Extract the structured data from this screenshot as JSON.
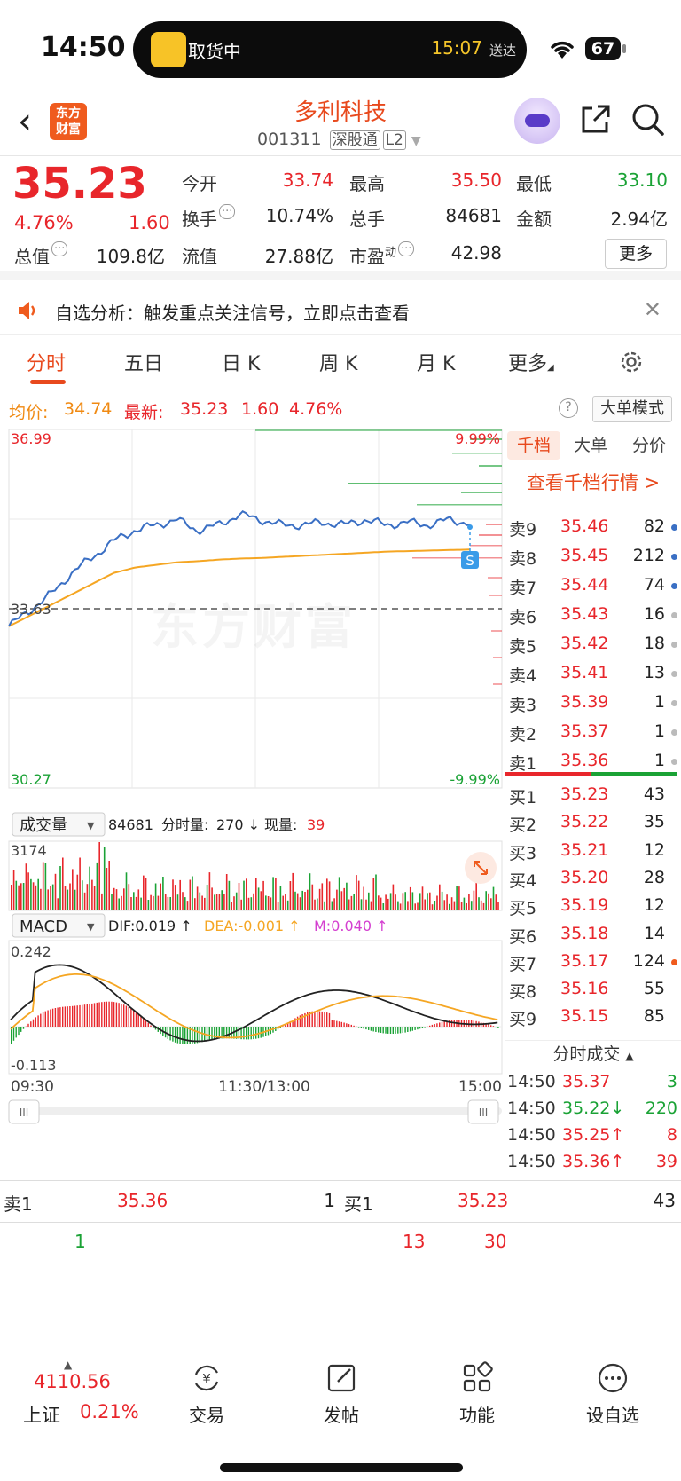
{
  "status": {
    "time": "14:50",
    "island_text": "取货中",
    "island_time": "15:07",
    "island_suffix": "送达",
    "battery": "67"
  },
  "header": {
    "stock_name": "多利科技",
    "code": "001311",
    "tag1": "深股通",
    "tag2": "L2",
    "logo_line1": "东方",
    "logo_line2": "财富"
  },
  "quote": {
    "price": "35.23",
    "pct": "4.76%",
    "chg": "1.60",
    "open_label": "今开",
    "open": "33.74",
    "high_label": "最高",
    "high": "35.50",
    "low_label": "最低",
    "low": "33.10",
    "turnover_label": "换手",
    "turnover": "10.74%",
    "vol_label": "总手",
    "vol": "84681",
    "amount_label": "金额",
    "amount": "2.94亿",
    "mktcap_label": "总值",
    "mktcap": "109.8亿",
    "float_label": "流值",
    "float": "27.88亿",
    "pe_label": "市盈",
    "pe_sup": "动",
    "pe": "42.98",
    "more": "更多"
  },
  "notice": {
    "text": "自选分析：触发重点关注信号，立即点击查看"
  },
  "tabs": [
    "分时",
    "五日",
    "日 K",
    "周 K",
    "月 K",
    "更多"
  ],
  "avgrow": {
    "avg_label": "均价:",
    "avg": "34.74",
    "latest_label": "最新:",
    "latest": "35.23",
    "chg": "1.60",
    "pct": "4.76%",
    "big_mode": "大单模式",
    "help": "?"
  },
  "chart": {
    "y_top": "36.99",
    "y_mid": "33.63",
    "y_bot": "30.27",
    "pct_top": "9.99%",
    "pct_bot": "-9.99%",
    "watermark": "东方财富",
    "vol_selector": "成交量",
    "vol_total": "84681",
    "vol_min_label": "分时量:",
    "vol_min": "270 ↓",
    "vol_now_label": "现量:",
    "vol_now": "39",
    "vol_max": "3174",
    "macd_selector": "MACD",
    "dif": "DIF:0.019 ↑",
    "dea": "DEA:-0.001 ↑",
    "m": "M:0.040 ↑",
    "macd_top": "0.242",
    "macd_bot": "-0.113",
    "x_start": "09:30",
    "x_mid": "11:30/13:00",
    "x_end": "15:00",
    "signal": "S",
    "scroll_handle": "III"
  },
  "chart_data": {
    "type": "line",
    "x": [
      "09:30",
      "11:30/13:00",
      "15:00"
    ],
    "ylim": [
      30.27,
      36.99
    ],
    "prev_close": 33.63,
    "series": [
      {
        "values": [
          33.3,
          33.6,
          33.9,
          34.3,
          34.6,
          34.9,
          35.1,
          35.2,
          35.3,
          35.1,
          35.2,
          35.4,
          35.3,
          35.2,
          35.2,
          35.25,
          35.2,
          35.3,
          35.2,
          35.25,
          35.2,
          35.3,
          35.23
        ]
      },
      {
        "values": [
          33.3,
          33.5,
          33.7,
          33.9,
          34.1,
          34.3,
          34.4,
          34.45,
          34.5,
          34.52,
          34.55,
          34.57,
          34.58,
          34.6,
          34.62,
          34.64,
          34.66,
          34.68,
          34.7,
          34.71,
          34.72,
          34.73,
          34.74
        ]
      }
    ]
  },
  "book": {
    "tabs": [
      "千档",
      "大单",
      "分价"
    ],
    "link": "查看千档行情 >",
    "asks": [
      {
        "label": "卖9",
        "price": "35.46",
        "vol": "82"
      },
      {
        "label": "卖8",
        "price": "35.45",
        "vol": "212"
      },
      {
        "label": "卖7",
        "price": "35.44",
        "vol": "74"
      },
      {
        "label": "卖6",
        "price": "35.43",
        "vol": "16"
      },
      {
        "label": "卖5",
        "price": "35.42",
        "vol": "18"
      },
      {
        "label": "卖4",
        "price": "35.41",
        "vol": "13"
      },
      {
        "label": "卖3",
        "price": "35.39",
        "vol": "1"
      },
      {
        "label": "卖2",
        "price": "35.37",
        "vol": "1"
      },
      {
        "label": "卖1",
        "price": "35.36",
        "vol": "1"
      }
    ],
    "bids": [
      {
        "label": "买1",
        "price": "35.23",
        "vol": "43"
      },
      {
        "label": "买2",
        "price": "35.22",
        "vol": "35"
      },
      {
        "label": "买3",
        "price": "35.21",
        "vol": "12"
      },
      {
        "label": "买4",
        "price": "35.20",
        "vol": "28"
      },
      {
        "label": "买5",
        "price": "35.19",
        "vol": "12"
      },
      {
        "label": "买6",
        "price": "35.18",
        "vol": "14"
      },
      {
        "label": "买7",
        "price": "35.17",
        "vol": "124"
      },
      {
        "label": "买8",
        "price": "35.16",
        "vol": "55"
      },
      {
        "label": "买9",
        "price": "35.15",
        "vol": "85"
      }
    ],
    "ticks_head": "分时成交",
    "ticks": [
      {
        "time": "14:50",
        "price": "35.37",
        "vol": "3"
      },
      {
        "time": "14:50",
        "price": "35.22↓",
        "vol": "220"
      },
      {
        "time": "14:50",
        "price": "35.25↑",
        "vol": "8"
      },
      {
        "time": "14:50",
        "price": "35.36↑",
        "vol": "39"
      }
    ]
  },
  "bpanel": {
    "ask_label": "卖1",
    "ask_price": "35.36",
    "ask_vol": "1",
    "bid_label": "买1",
    "bid_price": "35.23",
    "bid_vol": "43",
    "ask_detail": "1",
    "bid_detail1": "13",
    "bid_detail2": "30"
  },
  "bottomnav": {
    "index_value": "4110.56",
    "index_name": "上证",
    "index_pct": "0.21%",
    "items": [
      "交易",
      "发帖",
      "功能",
      "设自选"
    ]
  },
  "colors": {
    "up": "#e8262b",
    "down": "#1aa235",
    "brand": "#e8491d",
    "price_line": "#3a6fc4",
    "avg_line": "#f5a623"
  }
}
